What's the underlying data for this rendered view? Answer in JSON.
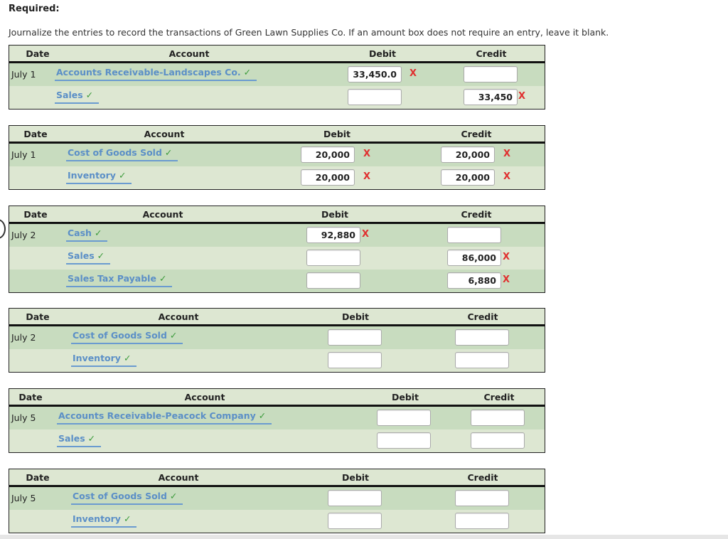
{
  "required_label": "Required:",
  "instructions": "Journalize the entries to record the transactions of Green Lawn Supplies Co. If an amount box does not require an entry, leave it blank.",
  "headers": {
    "date": "Date",
    "account": "Account",
    "debit": "Debit",
    "credit": "Credit"
  },
  "check_icon": "✓",
  "x_icon": "X",
  "entries": [
    {
      "rows": [
        {
          "date": "July 1",
          "account": "Accounts Receivable-Landscapes Co.",
          "debit": "33,450.0",
          "debit_wrong": true,
          "credit": "",
          "credit_wrong": false
        },
        {
          "date": "",
          "account": "Sales",
          "debit": "",
          "debit_wrong": false,
          "credit": "33,450",
          "credit_wrong": true
        }
      ]
    },
    {
      "rows": [
        {
          "date": "July 1",
          "account": "Cost of Goods Sold",
          "debit": "20,000",
          "debit_wrong": true,
          "credit": "20,000",
          "credit_wrong": true
        },
        {
          "date": "",
          "account": "Inventory",
          "debit": "20,000",
          "debit_wrong": true,
          "credit": "20,000",
          "credit_wrong": true
        }
      ]
    },
    {
      "rows": [
        {
          "date": "July 2",
          "account": "Cash",
          "debit": "92,880",
          "debit_wrong": true,
          "credit": "",
          "credit_wrong": false
        },
        {
          "date": "",
          "account": "Sales",
          "debit": "",
          "debit_wrong": false,
          "credit": "86,000",
          "credit_wrong": true
        },
        {
          "date": "",
          "account": "Sales Tax Payable",
          "debit": "",
          "debit_wrong": false,
          "credit": "6,880",
          "credit_wrong": true
        }
      ]
    },
    {
      "rows": [
        {
          "date": "July 2",
          "account": "Cost of Goods Sold",
          "debit": "",
          "debit_wrong": false,
          "credit": "",
          "credit_wrong": false
        },
        {
          "date": "",
          "account": "Inventory",
          "debit": "",
          "debit_wrong": false,
          "credit": "",
          "credit_wrong": false
        }
      ]
    },
    {
      "rows": [
        {
          "date": "July 5",
          "account": "Accounts Receivable-Peacock Company",
          "debit": "",
          "debit_wrong": false,
          "credit": "",
          "credit_wrong": false
        },
        {
          "date": "",
          "account": "Sales",
          "debit": "",
          "debit_wrong": false,
          "credit": "",
          "credit_wrong": false
        }
      ]
    },
    {
      "rows": [
        {
          "date": "July 5",
          "account": "Cost of Goods Sold",
          "debit": "",
          "debit_wrong": false,
          "credit": "",
          "credit_wrong": false
        },
        {
          "date": "",
          "account": "Inventory",
          "debit": "",
          "debit_wrong": false,
          "credit": "",
          "credit_wrong": false
        }
      ]
    }
  ]
}
